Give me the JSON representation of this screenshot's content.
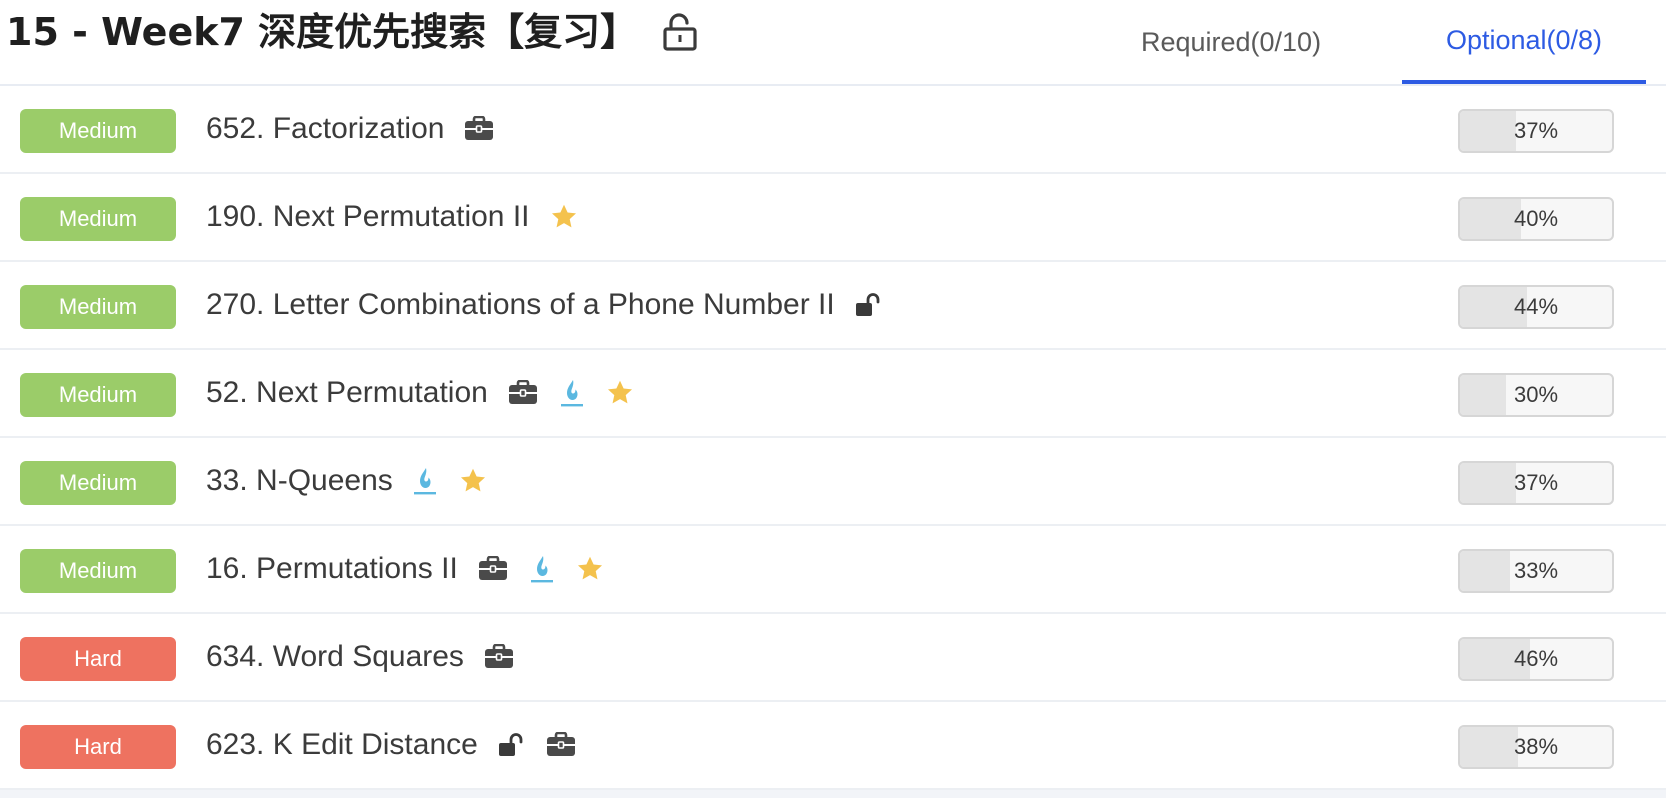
{
  "header": {
    "title": "15 - Week7 深度优先搜索【复习】",
    "title_icon": "lock-open-icon"
  },
  "tabs": [
    {
      "label": "Required(0/10)",
      "active": false
    },
    {
      "label": "Optional(0/8)",
      "active": true
    }
  ],
  "colors": {
    "medium": "#9bcc69",
    "hard": "#ee7260",
    "accent": "#2d5be3",
    "star": "#f4c24d",
    "flame": "#5bb8e0",
    "icon_dark": "#4a4a4a"
  },
  "problems": [
    {
      "difficulty": "Medium",
      "title": "652. Factorization",
      "icons": [
        "briefcase-icon"
      ],
      "pass_rate": "37%",
      "pass_fraction": 0.37
    },
    {
      "difficulty": "Medium",
      "title": "190. Next Permutation II",
      "icons": [
        "star-icon"
      ],
      "pass_rate": "40%",
      "pass_fraction": 0.4
    },
    {
      "difficulty": "Medium",
      "title": "270. Letter Combinations of a Phone Number II",
      "icons": [
        "lock-open-icon"
      ],
      "pass_rate": "44%",
      "pass_fraction": 0.44
    },
    {
      "difficulty": "Medium",
      "title": "52. Next Permutation",
      "icons": [
        "briefcase-icon",
        "flame-icon",
        "star-icon"
      ],
      "pass_rate": "30%",
      "pass_fraction": 0.3
    },
    {
      "difficulty": "Medium",
      "title": "33. N-Queens",
      "icons": [
        "flame-icon",
        "star-icon"
      ],
      "pass_rate": "37%",
      "pass_fraction": 0.37
    },
    {
      "difficulty": "Medium",
      "title": "16. Permutations II",
      "icons": [
        "briefcase-icon",
        "flame-icon",
        "star-icon"
      ],
      "pass_rate": "33%",
      "pass_fraction": 0.33
    },
    {
      "difficulty": "Hard",
      "title": "634. Word Squares",
      "icons": [
        "briefcase-icon"
      ],
      "pass_rate": "46%",
      "pass_fraction": 0.46
    },
    {
      "difficulty": "Hard",
      "title": "623. K Edit Distance",
      "icons": [
        "lock-open-icon",
        "briefcase-icon"
      ],
      "pass_rate": "38%",
      "pass_fraction": 0.38
    }
  ]
}
